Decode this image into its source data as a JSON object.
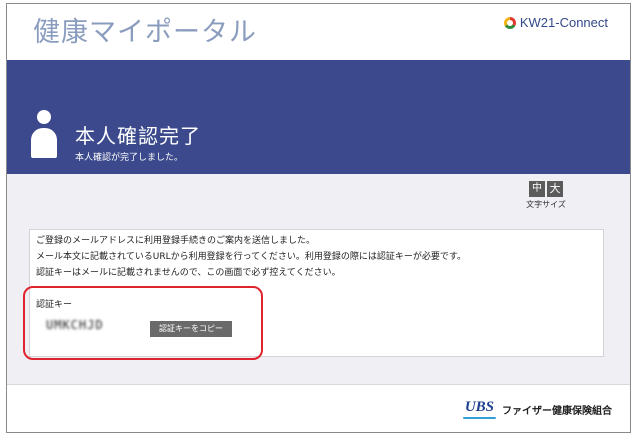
{
  "header": {
    "portal_title": "健康マイポータル",
    "brand_text": "KW21-Connect",
    "brand_icon": "kw21-logo-icon"
  },
  "banner": {
    "title": "本人確認完了",
    "subtitle": "本人確認が完了しました。",
    "icon": "person-icon",
    "background_color": "#3c4a8d"
  },
  "font_size": {
    "medium_label": "中",
    "large_label": "大",
    "caption": "文字サイズ"
  },
  "message": {
    "line1": "ご登録のメールアドレスに利用登録手続きのご案内を送信しました。",
    "line2": "メール本文に記載されているURLから利用登録を行ってください。利用登録の際には認証キーが必要です。",
    "line3": "認証キーはメールに記載されませんので、この画面で必ず控えてください。"
  },
  "auth": {
    "label": "認証キー",
    "value": "UMKCHJD",
    "copy_button": "認証キーをコピー",
    "highlight_color": "#e0242d"
  },
  "footer": {
    "logo_text": "UBS",
    "org_name": "ファイザー健康保険組合"
  }
}
